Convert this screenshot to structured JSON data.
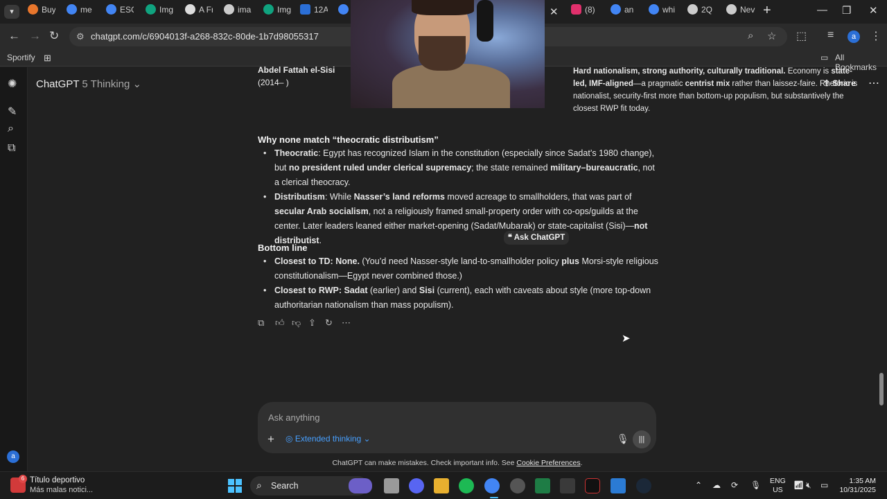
{
  "browser": {
    "tabs": [
      {
        "label": "Buy",
        "color": "#e8762c"
      },
      {
        "label": "me",
        "color": "#4285f4"
      },
      {
        "label": "ESG",
        "color": "#4285f4"
      },
      {
        "label": "Img",
        "color": "#10a37f"
      },
      {
        "label": "A Fr",
        "color": "#dddddd"
      },
      {
        "label": "ima",
        "color": "#cccccc"
      },
      {
        "label": "Img",
        "color": "#10a37f"
      },
      {
        "label": "12A",
        "color": "#2b6fd6"
      },
      {
        "label": "",
        "color": "#4285f4"
      },
      {
        "label": "(8)",
        "color": "#e1306c"
      },
      {
        "label": "an",
        "color": "#4285f4"
      },
      {
        "label": "whi",
        "color": "#4285f4"
      },
      {
        "label": "2Q",
        "color": "#cccccc"
      },
      {
        "label": "Nev",
        "color": "#cccccc"
      }
    ],
    "url": "chatgpt.com/c/6904013f-a268-832c-80de-1b7d98055317",
    "bookmarks": {
      "sportify": "Sportify",
      "all": "All Bookmarks"
    },
    "profile_initial": "a"
  },
  "chatgpt": {
    "model": "ChatGPT",
    "model_sub": "5 Thinking",
    "share": "Share",
    "rail_avatar": "a",
    "leader_name": "Abdel Fattah el-Sisi",
    "leader_years": "(2014– )",
    "leader_cell": {
      "p1": "Hard nationalism, strong authority, culturally traditional.",
      "p2": " Economy is ",
      "p3": "state-led, IMF-aligned",
      "p4": "—a pragmatic ",
      "p5": "centrist mix",
      "p6": " rather than laissez-faire. Rhetoric is nationalist, security-first more than bottom-up populism, but substantively the closest RWP fit today."
    },
    "why_heading": "Why none match “theocratic distributism”",
    "b1": {
      "a": "Theocratic",
      "b": ": Egypt has recognized Islam in the constitution (especially since Sadat’s 1980 change), but ",
      "c": "no president ruled under clerical supremacy",
      "d": "; the state remained ",
      "e": "military–bureaucratic",
      "f": ", not a clerical theocracy."
    },
    "b2": {
      "a": "Distributism",
      "b": ": While ",
      "c": "Nasser’s land reforms",
      "d": " moved acreage to smallholders, that was part of ",
      "e": "secular Arab socialism",
      "f": ", not a religiously framed small-property order with co-ops/guilds at the center. Later leaders leaned either market-opening (Sadat/Mubarak) or state-capitalist (Sisi)—",
      "g": "not distributist",
      "h": "."
    },
    "ask_popup": "Ask ChatGPT",
    "bottom_heading": "Bottom line",
    "b3": {
      "a": "Closest to TD: None.",
      "b": " (You’d need Nasser-style land-to-smallholder policy ",
      "c": "plus",
      "d": " Morsi-style religious constitutionalism—Egypt never combined those.)"
    },
    "b4": {
      "a": "Closest to RWP: Sadat",
      "b": " (earlier) and ",
      "c": "Sisi",
      "d": " (current), each with caveats about style (more top-down authoritarian nationalism than mass populism)."
    },
    "composer_placeholder": "Ask anything",
    "extended_thinking": "Extended thinking",
    "disclaimer": "ChatGPT can make mistakes. Check important info. See ",
    "disclaimer_link": "Cookie Preferences",
    "disclaimer_end": "."
  },
  "taskbar": {
    "news_badge": "6",
    "news_title": "Título deportivo",
    "news_sub": "Más malas notici...",
    "search_label": "Search",
    "lang1": "ENG",
    "lang2": "US",
    "time": "1:35 AM",
    "date": "10/31/2025"
  }
}
